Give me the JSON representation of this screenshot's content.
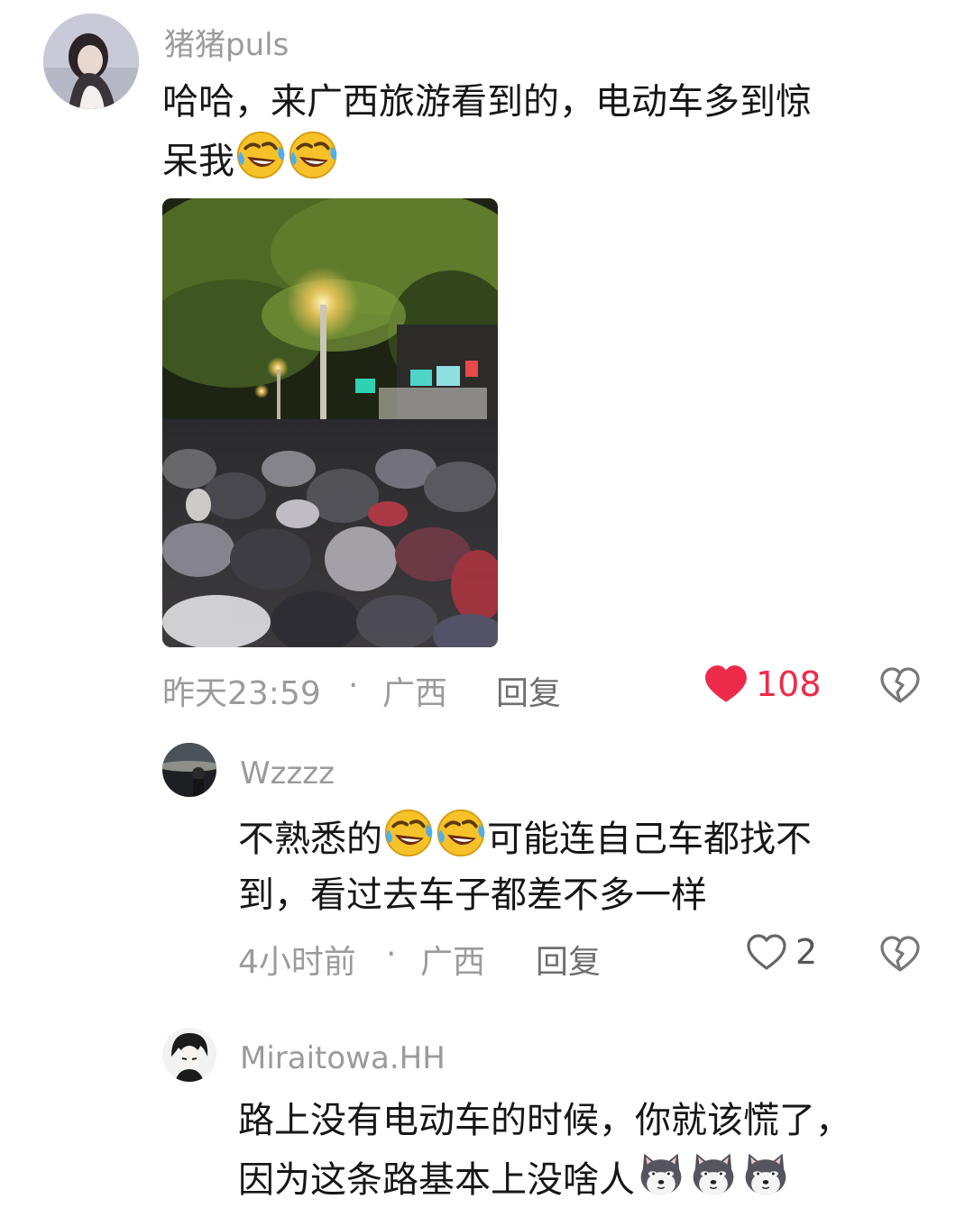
{
  "comments": [
    {
      "username": "猪猪puls",
      "text_lines": [
        "哈哈，来广西旅游看到的，电动车多到惊",
        "呆我"
      ],
      "emoji_icon": "rofl-emoji",
      "time": "昨天23:59",
      "dot": "·",
      "location": "广西",
      "reply_label": "回复",
      "likes": "108",
      "liked": true
    },
    {
      "username": "Wzzzz",
      "text_parts": [
        "不熟悉的",
        "可能连自己车都找不"
      ],
      "text_line2": "到，看过去车子都差不多一样",
      "emoji_icon": "rofl-emoji",
      "time": "4小时前",
      "dot": "·",
      "location": "广西",
      "reply_label": "回复",
      "likes": "2",
      "liked": false
    },
    {
      "username": "Miraitowa.HH",
      "text_lines": [
        "路上没有电动车的时候，你就该慌了，",
        "因为这条路基本上没啥人"
      ],
      "emoji_icon": "doge-emoji"
    }
  ],
  "colors": {
    "liked_heart": "#ee2a4a",
    "username": "#9b9b9b",
    "text": "#161616"
  }
}
